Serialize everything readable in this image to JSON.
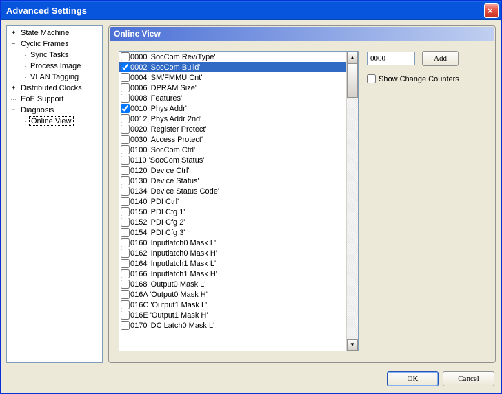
{
  "window": {
    "title": "Advanced Settings",
    "close": "×"
  },
  "tree": {
    "state_machine": "State Machine",
    "cyclic_frames": "Cyclic Frames",
    "sync_tasks": "Sync Tasks",
    "process_image": "Process Image",
    "vlan_tagging": "VLAN Tagging",
    "distributed_clocks": "Distributed Clocks",
    "eoe_support": "EoE Support",
    "diagnosis": "Diagnosis",
    "online_view": "Online View"
  },
  "panel": {
    "title": "Online View"
  },
  "registers": [
    {
      "code": "0000",
      "name": "'SocCom Rev/Type'",
      "checked": false,
      "sel": false
    },
    {
      "code": "0002",
      "name": "'SocCom Build'",
      "checked": true,
      "sel": true
    },
    {
      "code": "0004",
      "name": "'SM/FMMU Cnt'",
      "checked": false,
      "sel": false
    },
    {
      "code": "0006",
      "name": "'DPRAM Size'",
      "checked": false,
      "sel": false
    },
    {
      "code": "0008",
      "name": "'Features'",
      "checked": false,
      "sel": false
    },
    {
      "code": "0010",
      "name": "'Phys Addr'",
      "checked": true,
      "sel": false
    },
    {
      "code": "0012",
      "name": "'Phys Addr 2nd'",
      "checked": false,
      "sel": false
    },
    {
      "code": "0020",
      "name": "'Register Protect'",
      "checked": false,
      "sel": false
    },
    {
      "code": "0030",
      "name": "'Access Protect'",
      "checked": false,
      "sel": false
    },
    {
      "code": "0100",
      "name": "'SocCom Ctrl'",
      "checked": false,
      "sel": false
    },
    {
      "code": "0110",
      "name": "'SocCom Status'",
      "checked": false,
      "sel": false
    },
    {
      "code": "0120",
      "name": "'Device Ctrl'",
      "checked": false,
      "sel": false
    },
    {
      "code": "0130",
      "name": "'Device Status'",
      "checked": false,
      "sel": false
    },
    {
      "code": "0134",
      "name": "'Device Status Code'",
      "checked": false,
      "sel": false
    },
    {
      "code": "0140",
      "name": "'PDI Ctrl'",
      "checked": false,
      "sel": false
    },
    {
      "code": "0150",
      "name": "'PDI Cfg 1'",
      "checked": false,
      "sel": false
    },
    {
      "code": "0152",
      "name": "'PDI Cfg 2'",
      "checked": false,
      "sel": false
    },
    {
      "code": "0154",
      "name": "'PDI Cfg 3'",
      "checked": false,
      "sel": false
    },
    {
      "code": "0160",
      "name": "'Inputlatch0 Mask L'",
      "checked": false,
      "sel": false
    },
    {
      "code": "0162",
      "name": "'Inputlatch0 Mask H'",
      "checked": false,
      "sel": false
    },
    {
      "code": "0164",
      "name": "'Inputlatch1 Mask L'",
      "checked": false,
      "sel": false
    },
    {
      "code": "0166",
      "name": "'Inputlatch1 Mask H'",
      "checked": false,
      "sel": false
    },
    {
      "code": "0168",
      "name": "'Output0 Mask L'",
      "checked": false,
      "sel": false
    },
    {
      "code": "016A",
      "name": "'Output0 Mask H'",
      "checked": false,
      "sel": false
    },
    {
      "code": "016C",
      "name": "'Output1 Mask L'",
      "checked": false,
      "sel": false
    },
    {
      "code": "016E",
      "name": "'Output1 Mask H'",
      "checked": false,
      "sel": false
    },
    {
      "code": "0170",
      "name": "'DC Latch0 Mask L'",
      "checked": false,
      "sel": false
    }
  ],
  "side": {
    "input_value": "0000",
    "add_label": "Add",
    "show_counters_label": "Show Change Counters"
  },
  "footer": {
    "ok": "OK",
    "cancel": "Cancel"
  }
}
